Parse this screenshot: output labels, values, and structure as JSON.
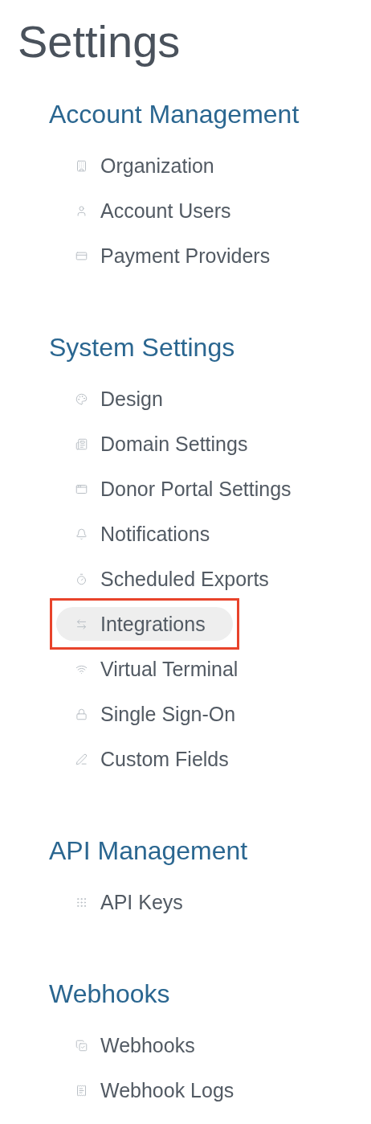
{
  "title": "Settings",
  "sections": [
    {
      "heading": "Account Management",
      "items": [
        {
          "label": "Organization",
          "kind": "building",
          "selected": false,
          "annotated": false
        },
        {
          "label": "Account Users",
          "kind": "user",
          "selected": false,
          "annotated": false
        },
        {
          "label": "Payment Providers",
          "kind": "card",
          "selected": false,
          "annotated": false
        }
      ]
    },
    {
      "heading": "System Settings",
      "items": [
        {
          "label": "Design",
          "kind": "palette",
          "selected": false,
          "annotated": false
        },
        {
          "label": "Domain Settings",
          "kind": "page",
          "selected": false,
          "annotated": false
        },
        {
          "label": "Donor Portal Settings",
          "kind": "window",
          "selected": false,
          "annotated": false
        },
        {
          "label": "Notifications",
          "kind": "bell",
          "selected": false,
          "annotated": false
        },
        {
          "label": "Scheduled Exports",
          "kind": "timer",
          "selected": false,
          "annotated": false
        },
        {
          "label": "Integrations",
          "kind": "arrows",
          "selected": true,
          "annotated": true
        },
        {
          "label": "Virtual Terminal",
          "kind": "terminal",
          "selected": false,
          "annotated": false
        },
        {
          "label": "Single Sign-On",
          "kind": "lock",
          "selected": false,
          "annotated": false
        },
        {
          "label": "Custom Fields",
          "kind": "pencil",
          "selected": false,
          "annotated": false
        }
      ]
    },
    {
      "heading": "API Management",
      "items": [
        {
          "label": "API Keys",
          "kind": "grid",
          "selected": false,
          "annotated": false
        }
      ]
    },
    {
      "heading": "Webhooks",
      "items": [
        {
          "label": "Webhooks",
          "kind": "copycheck",
          "selected": false,
          "annotated": false
        },
        {
          "label": "Webhook Logs",
          "kind": "receipt",
          "selected": false,
          "annotated": false
        }
      ]
    }
  ]
}
